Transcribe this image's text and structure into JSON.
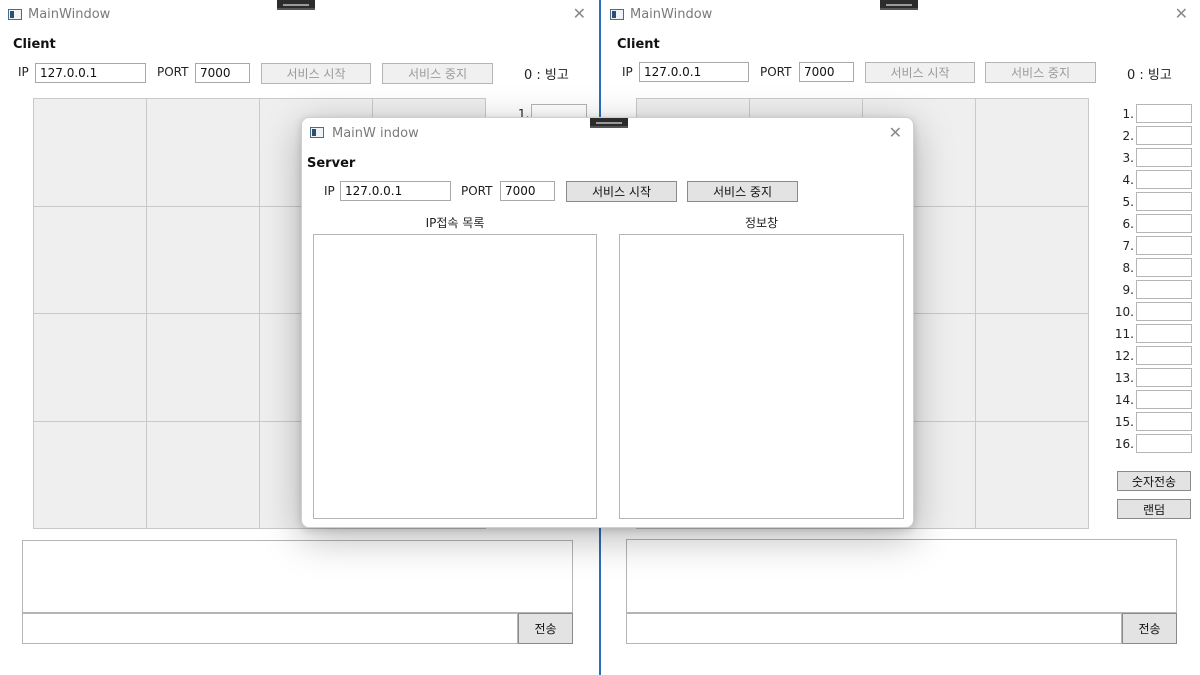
{
  "left_window": {
    "title": "MainWindow",
    "section_title": "Client",
    "ip_label": "IP",
    "ip_value": "127.0.0.1",
    "port_label": "PORT",
    "port_value": "7000",
    "start_button": "서비스 시작",
    "stop_button": "서비스 중지",
    "bingo_count": "0 : 빙고",
    "visible_number_label": "1.",
    "send_button": "전송"
  },
  "right_window": {
    "title": "MainWindow",
    "section_title": "Client",
    "ip_label": "IP",
    "ip_value": "127.0.0.1",
    "port_label": "PORT",
    "port_value": "7000",
    "start_button": "서비스 시작",
    "stop_button": "서비스 중지",
    "bingo_count": "0 : 빙고",
    "number_labels": [
      "1.",
      "2.",
      "3.",
      "4.",
      "5.",
      "6.",
      "7.",
      "8.",
      "9.",
      "10.",
      "11.",
      "12.",
      "13.",
      "14.",
      "15.",
      "16."
    ],
    "send_numbers_button": "숫자전송",
    "random_button": "랜덤",
    "send_button": "전송"
  },
  "server_dialog": {
    "title": "MainW indow",
    "section_title": "Server",
    "ip_label": "IP",
    "ip_value": "127.0.0.1",
    "port_label": "PORT",
    "port_value": "7000",
    "start_button": "서비스 시작",
    "stop_button": "서비스 중지",
    "connection_list_header": "IP접속 목록",
    "info_panel_header": "정보창"
  }
}
